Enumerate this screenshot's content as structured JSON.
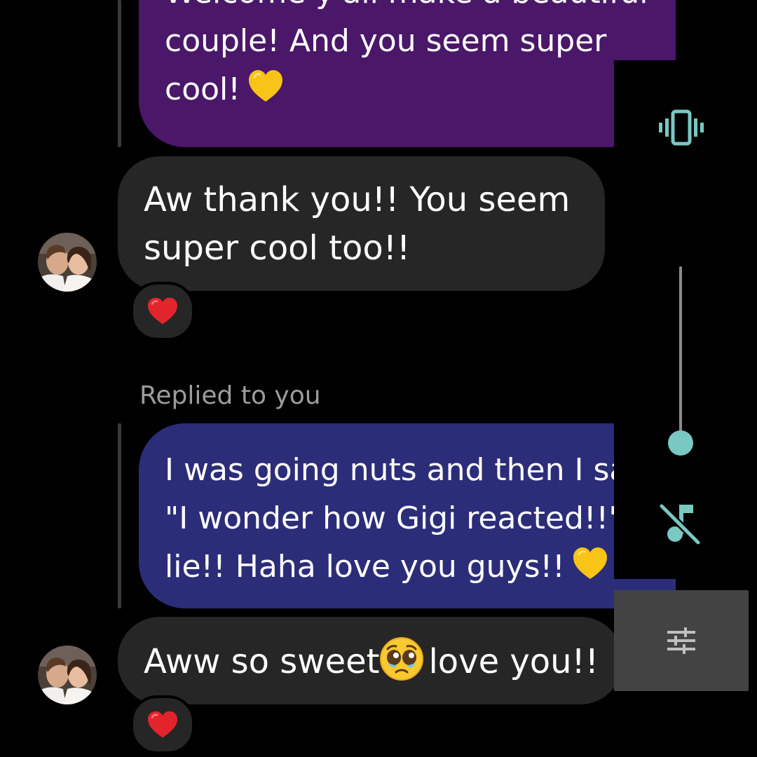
{
  "messages": [
    {
      "direction": "sent",
      "lines": [
        "Welcome y'all make a beautiful",
        "couple! And you seem super",
        "cool!"
      ],
      "trailing_emoji": "yellow-heart",
      "bubble_color": "#4a1769"
    },
    {
      "direction": "received",
      "lines": [
        "Aw thank you!! You seem",
        "super cool too!!"
      ],
      "reaction": "red-heart"
    },
    {
      "direction": "sent",
      "context_label": "Replied to you",
      "lines": [
        "I was going nuts and then I sai",
        "\"I wonder how Gigi reacted!!\" N",
        "lie!! Haha love you guys!!"
      ],
      "trailing_emoji": "yellow-heart",
      "bubble_color": "#2c2d79"
    },
    {
      "direction": "received",
      "text_before_emoji": "Aww so sweet",
      "inline_emoji": "pleading-face",
      "text_after_emoji": "love you!!",
      "reaction": "red-heart"
    }
  ],
  "volume_panel": {
    "ringer_mode_icon": "vibrate-icon",
    "media_icon": "music-muted-icon",
    "settings_icon": "sliders-icon",
    "level": 0,
    "accent_color": "#79c8c2"
  },
  "colors": {
    "background": "#000000",
    "received_bubble": "#262626",
    "label_gray": "#9c9c9c"
  }
}
